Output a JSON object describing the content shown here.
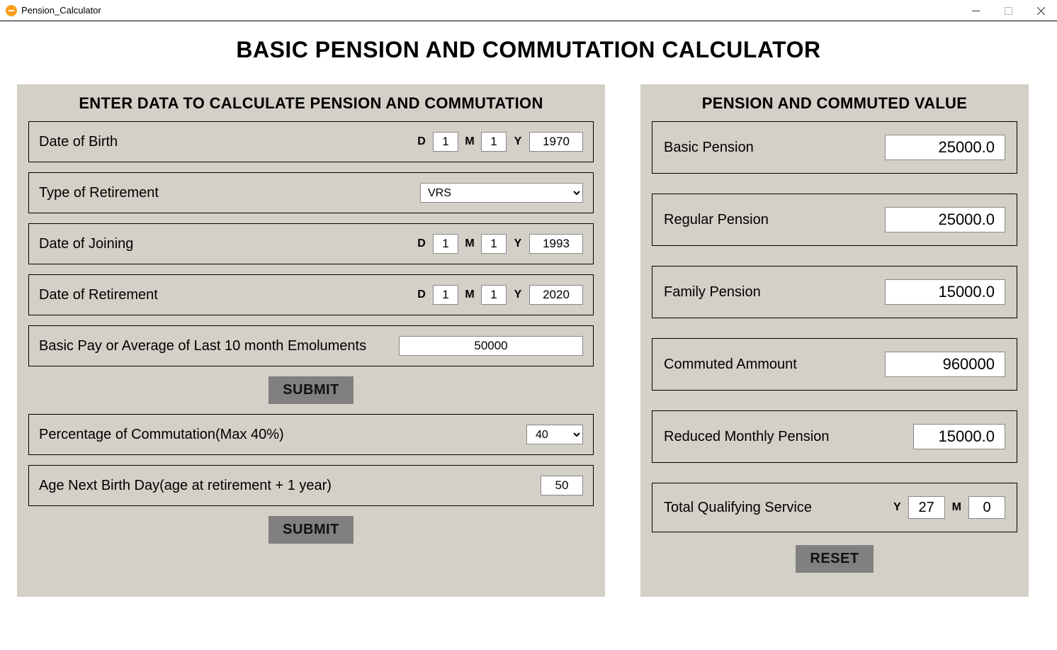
{
  "window": {
    "title": "Pension_Calculator"
  },
  "header": {
    "title": "BASIC PENSION AND COMMUTATION CALCULATOR"
  },
  "input_panel": {
    "title": "ENTER DATA TO CALCULATE PENSION AND COMMUTATION",
    "dob": {
      "label": "Date of Birth",
      "d_tag": "D",
      "m_tag": "M",
      "y_tag": "Y",
      "d": "1",
      "m": "1",
      "y": "1970"
    },
    "retire_type": {
      "label": "Type of Retirement",
      "value": "VRS"
    },
    "doj": {
      "label": "Date of Joining",
      "d_tag": "D",
      "m_tag": "M",
      "y_tag": "Y",
      "d": "1",
      "m": "1",
      "y": "1993"
    },
    "dor": {
      "label": "Date of Retirement",
      "d_tag": "D",
      "m_tag": "M",
      "y_tag": "Y",
      "d": "1",
      "m": "1",
      "y": "2020"
    },
    "basic_pay": {
      "label": "Basic Pay or Average of Last 10 month Emoluments",
      "value": "50000"
    },
    "submit_label": "SUBMIT",
    "commutation_pct": {
      "label": "Percentage of Commutation(Max 40%)",
      "value": "40"
    },
    "age_next_bday": {
      "label": "Age Next Birth Day(age at retirement + 1 year)",
      "value": "50"
    },
    "submit_label2": "SUBMIT"
  },
  "output_panel": {
    "title": "PENSION AND COMMUTED VALUE",
    "basic_pension": {
      "label": "Basic Pension",
      "value": "25000.0"
    },
    "regular_pension": {
      "label": "Regular Pension",
      "value": "25000.0"
    },
    "family_pension": {
      "label": "Family Pension",
      "value": "15000.0"
    },
    "commuted_amount": {
      "label": "Commuted Ammount",
      "value": "960000"
    },
    "reduced_monthly": {
      "label": "Reduced Monthly Pension",
      "value": "15000.0"
    },
    "tqs": {
      "label": "Total Qualifying Service",
      "y_tag": "Y",
      "m_tag": "M",
      "years": "27",
      "months": "0"
    },
    "reset_label": "RESET"
  }
}
